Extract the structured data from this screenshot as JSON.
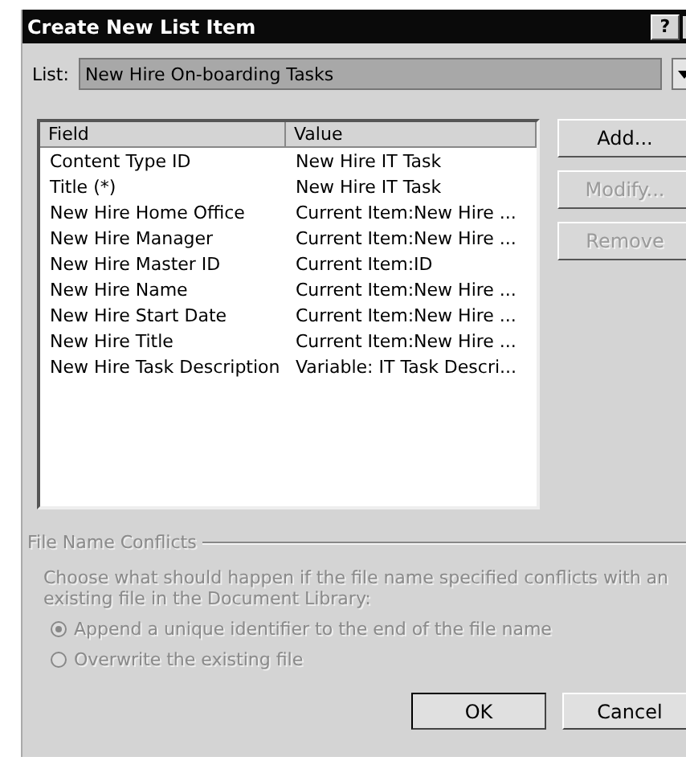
{
  "window": {
    "title": "Create New List Item",
    "help": "?"
  },
  "list": {
    "label": "List:",
    "value": "New Hire On-boarding Tasks"
  },
  "table": {
    "columns": [
      "Field",
      "Value"
    ],
    "rows": [
      [
        "Content Type ID",
        "New Hire IT Task"
      ],
      [
        "Title (*)",
        "New Hire IT Task"
      ],
      [
        "New Hire Home Office",
        "Current Item:New Hire ..."
      ],
      [
        "New Hire Manager",
        "Current Item:New Hire ..."
      ],
      [
        "New Hire Master ID",
        "Current Item:ID"
      ],
      [
        "New Hire Name",
        "Current Item:New Hire ..."
      ],
      [
        "New Hire Start Date",
        "Current Item:New Hire ..."
      ],
      [
        "New Hire Title",
        "Current Item:New Hire ..."
      ],
      [
        "New Hire Task Description",
        "Variable: IT Task Descri..."
      ]
    ]
  },
  "side_buttons": [
    {
      "label": "Add...",
      "disabled": false
    },
    {
      "label": "Modify...",
      "disabled": true
    },
    {
      "label": "Remove",
      "disabled": true
    }
  ],
  "conflicts": {
    "title": "File Name Conflicts",
    "disabled": true,
    "description": "Choose what should happen if the file name specified conflicts with an existing file in the Document Library:",
    "options": [
      {
        "label": "Append a unique identifier to the end of the file name",
        "selected": true
      },
      {
        "label": "Overwrite the existing file",
        "selected": false
      }
    ]
  },
  "buttons": [
    "OK",
    "Cancel"
  ]
}
